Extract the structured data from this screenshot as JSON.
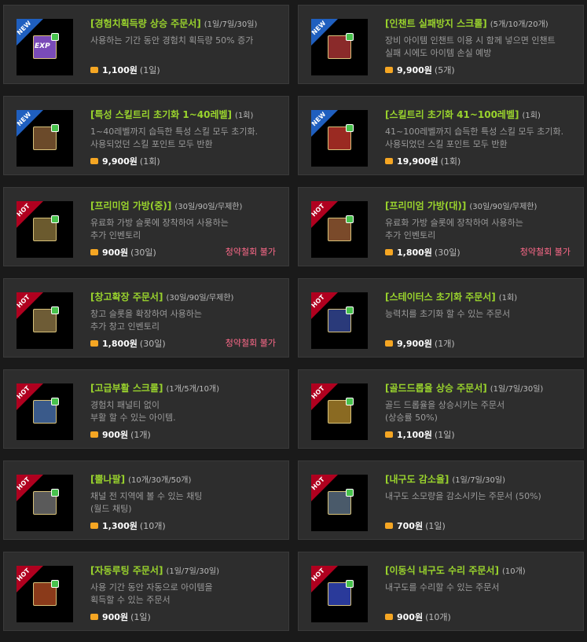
{
  "coin_icon": "coin-icon",
  "items": [
    {
      "badge": "NEW",
      "badge_color": "#1f5fbf",
      "icon": "exp-scroll-icon",
      "icon_color": "#7a4bb8",
      "icon_label": "EXP",
      "name": "[경험치획득량 상승 주문서]",
      "option": "(1일/7일/30일)",
      "desc1": "사용하는 기간 동안 경험치 획득량 50% 증가",
      "desc2": "",
      "price": "1,100원",
      "qty": "(1일)",
      "note": ""
    },
    {
      "badge": "NEW",
      "badge_color": "#1f5fbf",
      "icon": "enchant-scroll-icon",
      "icon_color": "#8a2a2a",
      "icon_label": "",
      "name": "[인챈트 실패방지 스크롤]",
      "option": "(5개/10개/20개)",
      "desc1": "장비 아이템 인챈트 이용 시 함께 넣으면 인챈트",
      "desc2": "실패 시에도 아이템 손실 예방",
      "price": "9,900원",
      "qty": "(5개)",
      "note": ""
    },
    {
      "badge": "NEW",
      "badge_color": "#1f5fbf",
      "icon": "skill-reset-book-icon",
      "icon_color": "#6b4a2a",
      "icon_label": "",
      "name": "[특성 스킬트리 초기화 1~40레벨]",
      "option": "(1회)",
      "desc1": "1~40레벨까지 습득한 특성 스킬 모두 초기화.",
      "desc2": "사용되었던 스킬 포인트 모두 반환",
      "price": "9,900원",
      "qty": "(1회)",
      "note": ""
    },
    {
      "badge": "NEW",
      "badge_color": "#1f5fbf",
      "icon": "skill-reset-book-red-icon",
      "icon_color": "#9a2a22",
      "icon_label": "",
      "name": "[스킬트리 초기화 41~100레벨]",
      "option": "(1회)",
      "desc1": "41~100레벨까지 습득한 특성 스킬 모두 초기화.",
      "desc2": "사용되었던 스킬 포인트 모두 반환",
      "price": "19,900원",
      "qty": "(1회)",
      "note": ""
    },
    {
      "badge": "HOT",
      "badge_color": "#b0001f",
      "icon": "premium-bag-medium-icon",
      "icon_color": "#6b5a2e",
      "icon_label": "",
      "name": "[프리미엄 가방(중)]",
      "option": "(30일/90일/무제한)",
      "desc1": "유료화 가방 슬롯에 장착하여 사용하는",
      "desc2": "추가 인벤토리",
      "price": "900원",
      "qty": "(30일)",
      "note": "청약철회 불가"
    },
    {
      "badge": "HOT",
      "badge_color": "#b0001f",
      "icon": "premium-bag-large-icon",
      "icon_color": "#7a4a2a",
      "icon_label": "",
      "name": "[프리미엄 가방(대)]",
      "option": "(30일/90일/무제한)",
      "desc1": "유료화 가방 슬롯에 장착하여 사용하는",
      "desc2": "추가 인벤토리",
      "price": "1,800원",
      "qty": "(30일)",
      "note": "청약철회 불가"
    },
    {
      "badge": "HOT",
      "badge_color": "#b0001f",
      "icon": "storage-expand-scroll-icon",
      "icon_color": "#6e5c36",
      "icon_label": "",
      "name": "[창고확장 주문서]",
      "option": "(30일/90일/무제한)",
      "desc1": "창고 슬롯을 확장하여 사용하는",
      "desc2": "추가 창고 인벤토리",
      "price": "1,800원",
      "qty": "(30일)",
      "note": "청약철회 불가"
    },
    {
      "badge": "HOT",
      "badge_color": "#b0001f",
      "icon": "status-reset-scroll-icon",
      "icon_color": "#2a3a7a",
      "icon_label": "",
      "name": "[스테이터스 초기화 주문서]",
      "option": "(1회)",
      "desc1": "능력치를 초기화 할 수 있는 주문서",
      "desc2": "",
      "price": "9,900원",
      "qty": "(1개)",
      "note": ""
    },
    {
      "badge": "HOT",
      "badge_color": "#b0001f",
      "icon": "resurrection-scroll-icon",
      "icon_color": "#3a5a8a",
      "icon_label": "",
      "name": "[고급부활 스크롤]",
      "option": "(1개/5개/10개)",
      "desc1": "경험치 패널티 없이",
      "desc2": "부활 할 수 있는 아이템.",
      "price": "900원",
      "qty": "(1개)",
      "note": ""
    },
    {
      "badge": "HOT",
      "badge_color": "#b0001f",
      "icon": "gold-drop-scroll-icon",
      "icon_color": "#8a6a22",
      "icon_label": "",
      "name": "[골드드롭율 상승 주문서]",
      "option": "(1일/7일/30일)",
      "desc1": "골드 드롭율을 상승시키는 주문서",
      "desc2": "(상승률 50%)",
      "price": "1,100원",
      "qty": "(1일)",
      "note": ""
    },
    {
      "badge": "HOT",
      "badge_color": "#b0001f",
      "icon": "megaphone-icon",
      "icon_color": "#5a5a5a",
      "icon_label": "",
      "name": "[뿔나팔]",
      "option": "(10개/30개/50개)",
      "desc1": "채널 전 지역에 볼 수 있는 채팅",
      "desc2": "(월드 채팅)",
      "price": "1,300원",
      "qty": "(10개)",
      "note": ""
    },
    {
      "badge": "HOT",
      "badge_color": "#b0001f",
      "icon": "durability-scroll-icon",
      "icon_color": "#4a5a6a",
      "icon_label": "",
      "name": "[내구도 감소율]",
      "option": "(1일/7일/30일)",
      "desc1": "내구도 소모량을 감소시키는 주문서 (50%)",
      "desc2": "",
      "price": "700원",
      "qty": "(1일)",
      "note": ""
    },
    {
      "badge": "HOT",
      "badge_color": "#b0001f",
      "icon": "auto-loot-scroll-icon",
      "icon_color": "#8a3a1a",
      "icon_label": "",
      "name": "[자동루팅 주문서]",
      "option": "(1일/7일/30일)",
      "desc1": "사용 기간 동안 자동으로 아이템을",
      "desc2": "획득할 수 있는 주문서",
      "price": "900원",
      "qty": "(1일)",
      "note": ""
    },
    {
      "badge": "HOT",
      "badge_color": "#b0001f",
      "icon": "repair-scroll-icon",
      "icon_color": "#2a3a9a",
      "icon_label": "",
      "name": "[이동식 내구도 수리 주문서]",
      "option": "(10개)",
      "desc1": "내구도를 수리할 수 있는 주문서",
      "desc2": "",
      "price": "900원",
      "qty": "(10개)",
      "note": ""
    }
  ]
}
